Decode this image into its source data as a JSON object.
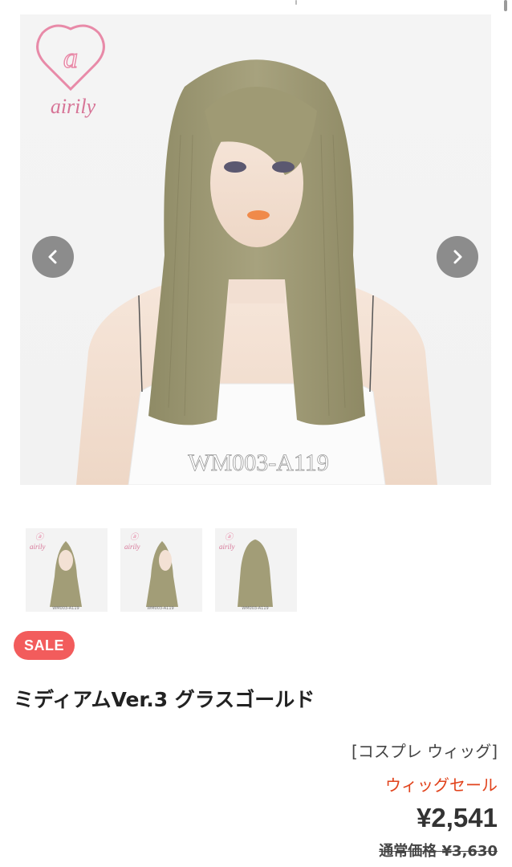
{
  "hero": {
    "brand_logo_text": "airily",
    "brand_logo_letter": "a",
    "watermark": "WM003-A119"
  },
  "thumbnails": [
    {
      "logo": "airily",
      "code": "WM003-A119",
      "view": "front"
    },
    {
      "logo": "airily",
      "code": "WM003-A119",
      "view": "angle"
    },
    {
      "logo": "airily",
      "code": "WM003-A119",
      "view": "back"
    }
  ],
  "badge": {
    "label": "SALE",
    "color": "#f25c5c"
  },
  "product": {
    "title": "ミディアムVer.3 グラスゴールド",
    "category": "[コスプレ ウィッグ]",
    "sale_label": "ウィッグセール",
    "price": "¥2,541",
    "regular_price": "通常価格 ¥3,630"
  },
  "colors": {
    "accent_red": "#e1431c",
    "badge": "#f25c5c",
    "logo_pink": "#e88aa8"
  },
  "icons": {
    "prev": "chevron-left-icon",
    "next": "chevron-right-icon"
  }
}
